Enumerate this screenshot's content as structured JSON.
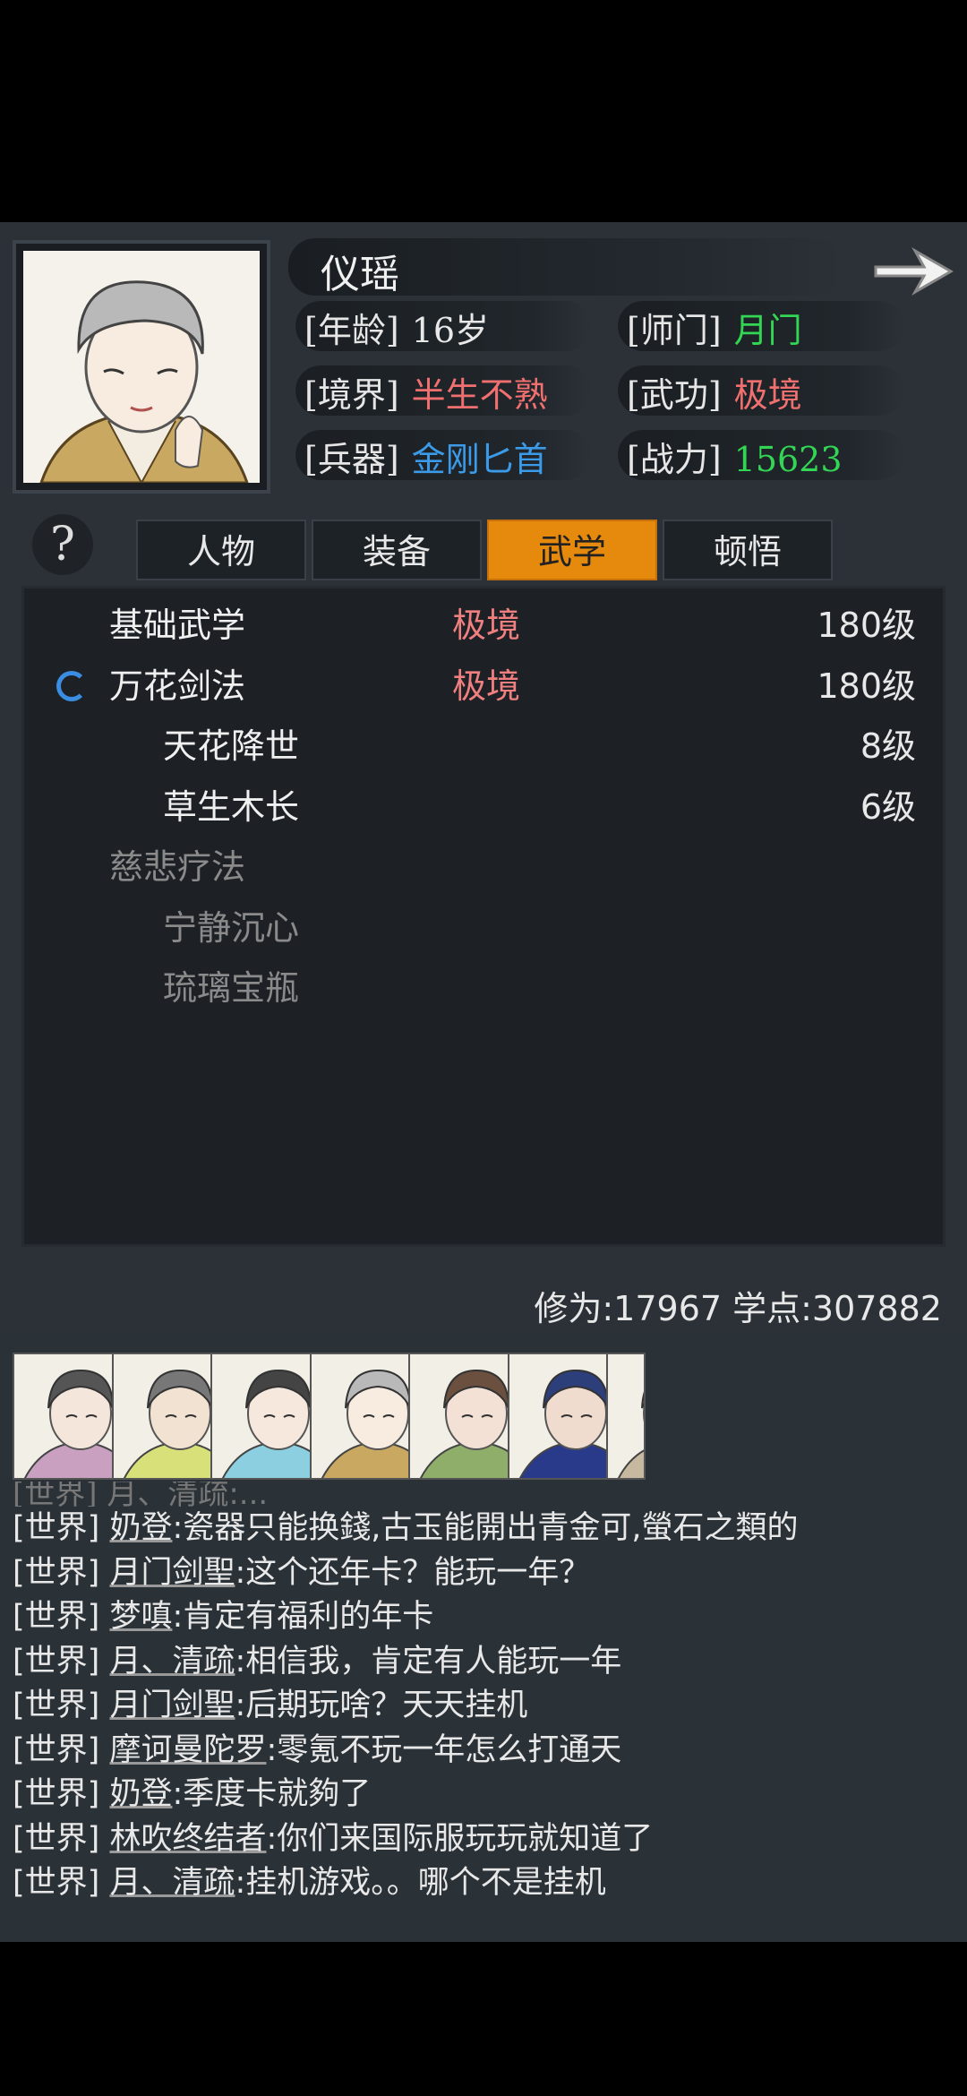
{
  "character": {
    "name": "仪瑶",
    "stats": [
      {
        "label": "[年龄]",
        "value": "16岁",
        "color": "#e8e8e8"
      },
      {
        "label": "[师门]",
        "value": "月门",
        "color": "#33d654"
      },
      {
        "label": "[境界]",
        "value": "半生不熟",
        "color": "#f07070"
      },
      {
        "label": "[武功]",
        "value": "极境",
        "color": "#f07070"
      },
      {
        "label": "[兵器]",
        "value": "金刚匕首",
        "color": "#3b9be8"
      },
      {
        "label": "[战力]",
        "value": "15623",
        "color": "#33d654"
      }
    ]
  },
  "tabs": {
    "help": "?",
    "items": [
      "人物",
      "装备",
      "武学",
      "顿悟"
    ],
    "active_index": 2
  },
  "skills": [
    {
      "name": "基础武学",
      "tier": "极境",
      "level": "180级",
      "indent": 0,
      "learned": true,
      "active": false
    },
    {
      "name": "万花剑法",
      "tier": "极境",
      "level": "180级",
      "indent": 0,
      "learned": true,
      "active": true
    },
    {
      "name": "天花降世",
      "tier": "",
      "level": "8级",
      "indent": 1,
      "learned": true,
      "active": false
    },
    {
      "name": "草生木长",
      "tier": "",
      "level": "6级",
      "indent": 1,
      "learned": true,
      "active": false
    },
    {
      "name": "慈悲疗法",
      "tier": "",
      "level": "",
      "indent": 0,
      "learned": false,
      "active": false
    },
    {
      "name": "宁静沉心",
      "tier": "",
      "level": "",
      "indent": 1,
      "learned": false,
      "active": false
    },
    {
      "name": "琉璃宝瓶",
      "tier": "",
      "level": "",
      "indent": 1,
      "learned": false,
      "active": false
    }
  ],
  "points": {
    "text": "修为:17967 学点:307882"
  },
  "avatars_count": 7,
  "chat": {
    "channel": "[世界]",
    "messages": [
      {
        "user": "奶登",
        "text": ":瓷器只能换錢,古玉能開出青金可,螢石之類的"
      },
      {
        "user": "月门剑聖",
        "text": ":这个还年卡？能玩一年？"
      },
      {
        "user": "梦嗔",
        "text": ":肯定有福利的年卡"
      },
      {
        "user": "月、清疏",
        "text": ":相信我，肯定有人能玩一年"
      },
      {
        "user": "月门剑聖",
        "text": ":后期玩啥？天天挂机"
      },
      {
        "user": "摩诃曼陀罗",
        "text": ":零氪不玩一年怎么打通天"
      },
      {
        "user": "奶登",
        "text": ":季度卡就夠了"
      },
      {
        "user": "林吹终结者",
        "text": ":你们来国际服玩玩就知道了"
      },
      {
        "user": "月、清疏",
        "text": ":挂机游戏。。哪个不是挂机"
      }
    ]
  }
}
